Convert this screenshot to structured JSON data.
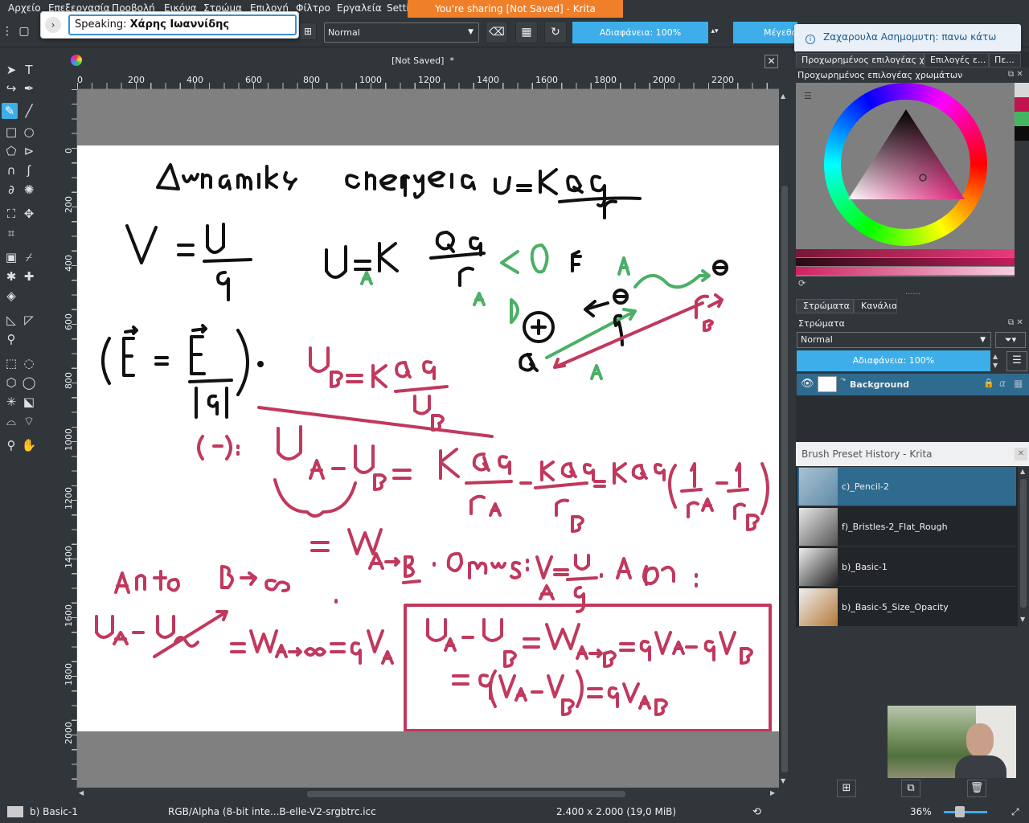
{
  "menu": [
    "Αρχείο",
    "Επεξεργασία",
    "Προβολή",
    "Εικόνα",
    "Στρώμα",
    "Επιλογή",
    "Φίλτρο",
    "Εργαλεία",
    "Setti"
  ],
  "share_banner": "You're sharing  [Not Saved]  - Krita",
  "speaking": {
    "label": "Speaking:",
    "name": "Χάρης Ιωαννίδης"
  },
  "toolbar": {
    "blend_mode": "Normal",
    "opacity": "Αδιαφάνεια: 100%",
    "size_label": "Μέγεθο"
  },
  "notification": "Ζαχαρουλα Ασημομυτη: πανω κάτω",
  "document": {
    "title": "[Not Saved]",
    "modified": "*"
  },
  "ruler_h": [
    "200",
    "400",
    "600",
    "800",
    "1000",
    "1200",
    "1400",
    "1600",
    "1800",
    "2000",
    "2200"
  ],
  "ruler_v": [
    "0",
    "200",
    "400",
    "600",
    "800",
    "1000",
    "1200",
    "1400",
    "1600",
    "1800",
    "2000"
  ],
  "dock_tabs": [
    "Προχωρημένος επιλογέας χ...",
    "Επιλογές ε...",
    "Πε..."
  ],
  "color_selector_title": "Προχωρημένος επιλογέας χρωμάτων",
  "layers": {
    "tabs": [
      "Στρώματα",
      "Κανάλια"
    ],
    "title": "Στρώματα",
    "blend": "Normal",
    "opacity": "Αδιαφάνεια:  100%",
    "items": [
      {
        "name": "Background"
      }
    ]
  },
  "brush_history": {
    "title": "Brush Preset History - Krita",
    "items": [
      "c)_Pencil-2",
      "f)_Bristles-2_Flat_Rough",
      "b)_Basic-1",
      "b)_Basic-5_Size_Opacity"
    ]
  },
  "status": {
    "brush": "b) Basic-1",
    "colorspace": "RGB/Alpha (8-bit inte...B-elle-V2-srgbtrc.icc",
    "dimensions": "2.400 x 2.000 (19,0 MiB)",
    "zoom": "36%"
  },
  "colors": {
    "accent": "#3daee9",
    "share": "#f07f2a",
    "ink_red": "#c0395d",
    "ink_green": "#4caf66",
    "ink_black": "#111111"
  }
}
